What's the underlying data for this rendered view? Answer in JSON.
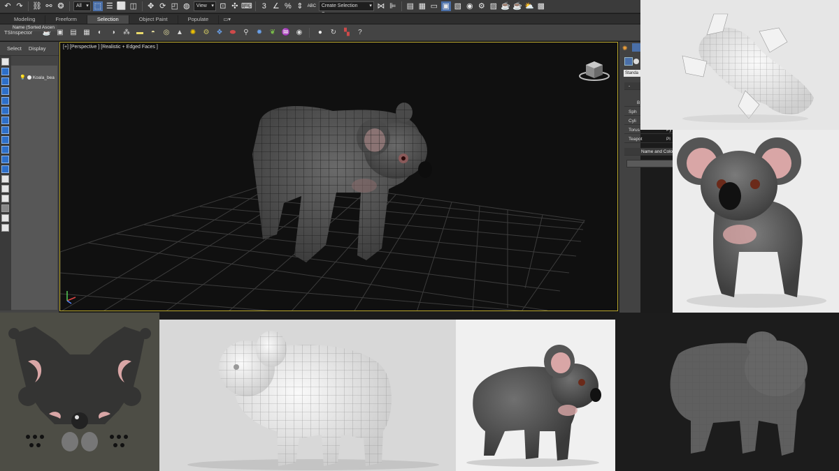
{
  "toolbar": {
    "selection_filter": "All",
    "reference_coord": "View",
    "create_selection_set": "Create Selection Se",
    "snap_3": "3",
    "snap_n": "n",
    "snap_percent": "%",
    "abc": "ABC"
  },
  "ribbon": {
    "tabs": [
      "Modeling",
      "Freeform",
      "Selection",
      "Object Paint",
      "Populate"
    ],
    "active_tab": "Selection",
    "label": "TSInspector"
  },
  "explorer": {
    "tabs": [
      "Select",
      "Display"
    ],
    "column_header": "Name (Sorted Ascen",
    "item": "Koala_bea"
  },
  "viewport": {
    "label": "[+] [Perspective ] [Realistic + Edged Faces ]"
  },
  "command_panel": {
    "dropdown": "Standa",
    "buttons": [
      "B",
      "Sph",
      "Cyli",
      "Torus",
      "Teapot"
    ],
    "buttons_right": [
      "Py",
      "Pl"
    ],
    "rollout": "Name and Colo"
  },
  "colors": {
    "viewport_border": "#b7a52c",
    "active_blue": "#4a6fa8",
    "koala_gray": "#5b5b5b",
    "ear_pink": "#d9a6a6"
  }
}
